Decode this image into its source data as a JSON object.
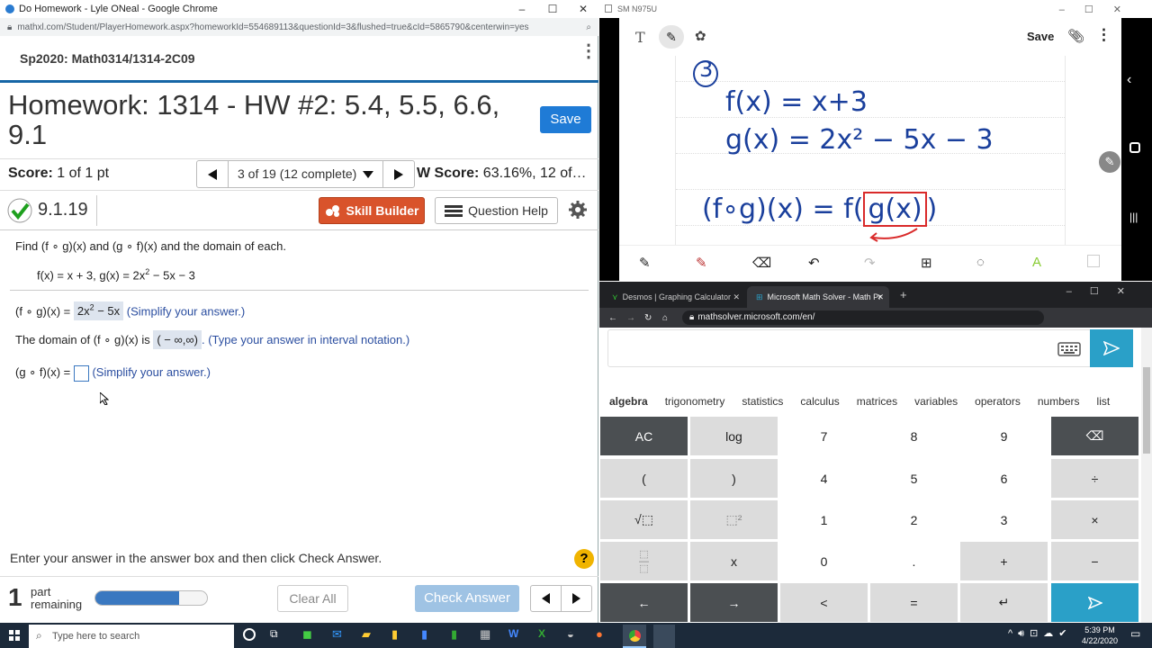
{
  "left_window": {
    "title": "Do Homework - Lyle ONeal - Google Chrome",
    "url": "mathxl.com/Student/PlayerHomework.aspx?homeworkId=554689113&questionId=3&flushed=true&cId=5865790&centerwin=yes",
    "course": "Sp2020: Math0314/1314-2C09",
    "homework_title": "Homework: 1314 - HW #2: 5.4, 5.5, 6.6, 9.1",
    "save_label": "Save",
    "score_label": "Score:",
    "score_value": "1 of 1 pt",
    "question_nav": "3 of 19 (12 complete)",
    "hw_score_label": "W Score:",
    "hw_score_value": "63.16%, 12 of…",
    "question_number": "9.1.19",
    "skill_builder_label": "Skill Builder",
    "question_help_label": "Question Help",
    "prompt": "Find (f ∘ g)(x) and (g ∘ f)(x) and the domain of each.",
    "given": {
      "f_part": "f(x) = x + 3, g(x) = 2x",
      "exp": "2",
      "rest": " − 5x − 3"
    },
    "fog": {
      "label": "(f ∘ g)(x) = ",
      "ans_main": "2x",
      "ans_exp": "2",
      "ans_rest": " − 5x",
      "hint": "(Simplify your answer.)"
    },
    "domain": {
      "label": "The domain of (f ∘ g)(x) is ",
      "answer": "( − ∞,∞)",
      "hint": ". (Type your answer in interval notation.)"
    },
    "gof": {
      "label": "(g ∘ f)(x) = ",
      "hint": "(Simplify your answer.)"
    },
    "instructions": "Enter your answer in the answer box and then click Check Answer.",
    "help_symbol": "?",
    "parts_count": "1",
    "parts_label_1": "part",
    "parts_label_2": "remaining",
    "progress": 0.75,
    "clear_all_label": "Clear All",
    "check_answer_label": "Check Answer"
  },
  "notes_window": {
    "title": "SM N975U",
    "save_label": "Save",
    "lines": {
      "num": "3",
      "f": "f(x) = x+3",
      "g": "g(x) = 2x² − 5x − 3",
      "comp_left": "(f∘g)(x) =  f(",
      "comp_box": "g(x)",
      "comp_right": ")"
    }
  },
  "right_window": {
    "tab1": "Desmos | Graphing Calculator",
    "tab2": "Microsoft Math Solver - Math Pr",
    "url": "mathsolver.microsoft.com/en/",
    "categories": [
      "algebra",
      "trigonometry",
      "statistics",
      "calculus",
      "matrices",
      "variables",
      "operators",
      "numbers",
      "list"
    ],
    "keys": {
      "ac": "AC",
      "log": "log",
      "k7": "7",
      "k8": "8",
      "k9": "9",
      "lparen": "(",
      "rparen": ")",
      "k4": "4",
      "k5": "5",
      "k6": "6",
      "divide": "÷",
      "k1": "1",
      "k2": "2",
      "k3": "3",
      "times": "×",
      "x": "x",
      "k0": "0",
      "dot": ".",
      "plus": "+",
      "minus": "−",
      "left": "←",
      "right": "→",
      "lt": "<",
      "eq": "=",
      "enter": "↵"
    }
  },
  "taskbar": {
    "search_placeholder": "Type here to search",
    "time": "5:39 PM",
    "date": "4/22/2020"
  }
}
